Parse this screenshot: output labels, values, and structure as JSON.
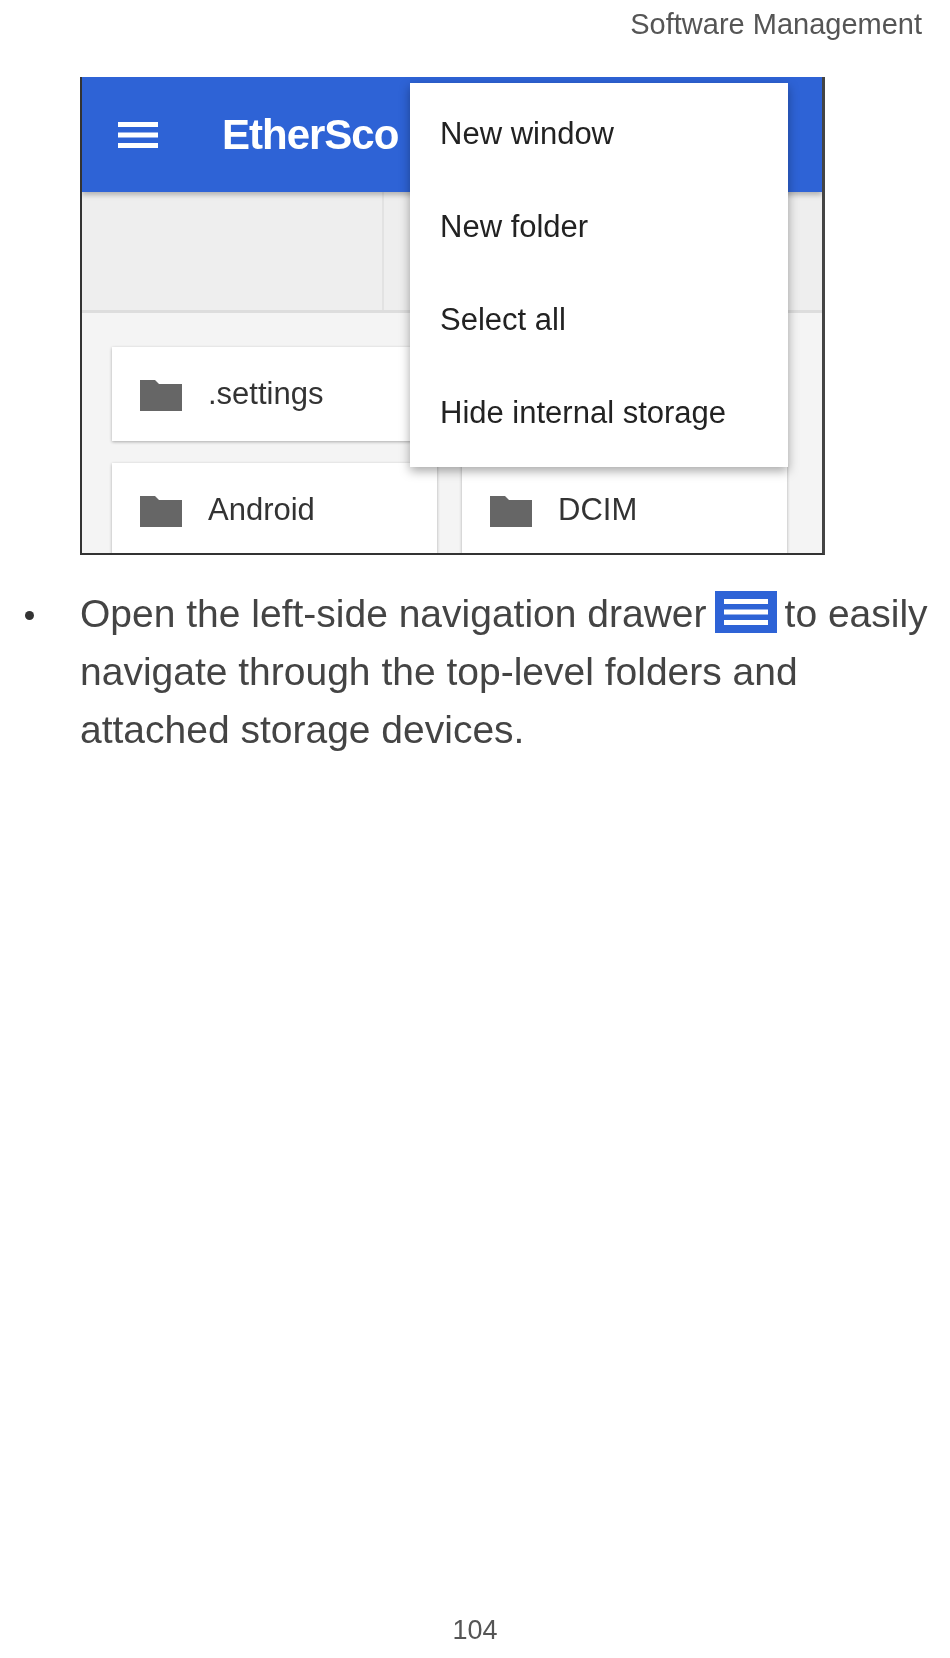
{
  "header": "Software Management",
  "app_screenshot": {
    "app_bar": {
      "title": "EtherSco"
    },
    "menu": [
      {
        "label": "New window"
      },
      {
        "label": "New folder"
      },
      {
        "label": "Select all"
      },
      {
        "label": "Hide internal storage"
      }
    ],
    "folders": [
      {
        "name": ".settings"
      },
      {
        "name": "Android"
      },
      {
        "name": "DCIM"
      }
    ]
  },
  "bullets": [
    {
      "before_icon": "Open the left-side navigation drawer",
      "after_icon": "to easily navigate through the top-level folders and attached storage devices."
    }
  ],
  "page_number": "104"
}
